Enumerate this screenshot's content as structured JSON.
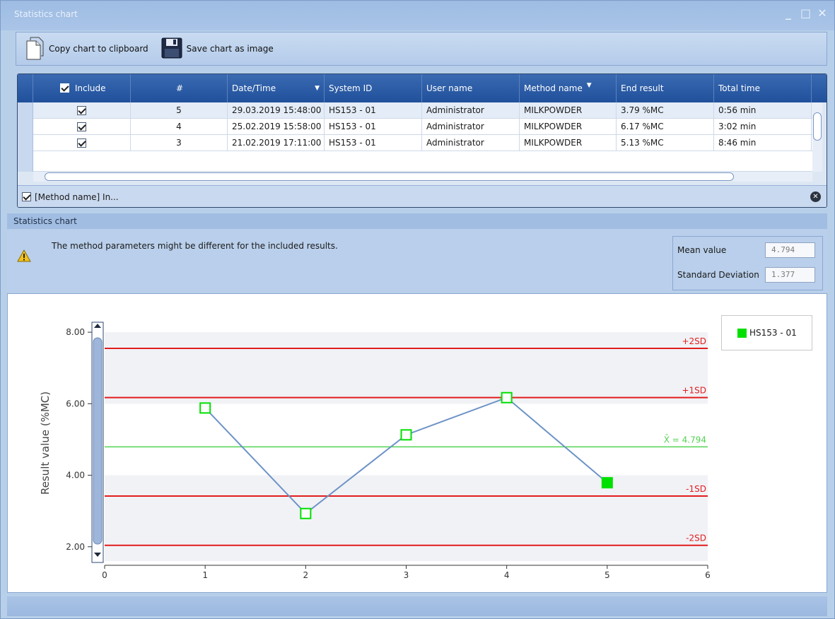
{
  "window": {
    "title": "Statistics chart",
    "minimize": "_",
    "maximize": "□",
    "close": "✕"
  },
  "toolbar": {
    "copy_label": "Copy chart  to clipboard",
    "save_label": "Save chart as image"
  },
  "grid": {
    "columns": [
      "Include",
      "#",
      "Date/Time",
      "System ID",
      "User name",
      "Method name",
      "End result",
      "Total time"
    ],
    "rows": [
      {
        "include": true,
        "num": "5",
        "datetime": "29.03.2019 15:48:00",
        "system_id": "HS153 - 01",
        "user": "Administrator",
        "method": "MILKPOWDER",
        "result": "3.79 %MC",
        "time": "0:56 min"
      },
      {
        "include": true,
        "num": "4",
        "datetime": "25.02.2019 15:58:00",
        "system_id": "HS153 - 01",
        "user": "Administrator",
        "method": "MILKPOWDER",
        "result": "6.17 %MC",
        "time": "3:02 min"
      },
      {
        "include": true,
        "num": "3",
        "datetime": "21.02.2019 17:11:00",
        "system_id": "HS153 - 01",
        "user": "Administrator",
        "method": "MILKPOWDER",
        "result": "5.13 %MC",
        "time": "8:46 min"
      }
    ],
    "filter_text": "[Method name] In..."
  },
  "stats": {
    "section_title": "Statistics chart",
    "warning": "The method parameters might be different for the included results.",
    "mean_label": "Mean value",
    "mean_value": "4.794",
    "sd_label": "Standard Deviation",
    "sd_value": "1.377"
  },
  "colors": {
    "point": "#00e000",
    "line": "#6d93c6",
    "limit": "#e21d1d",
    "mean": "#52d352"
  },
  "chart_data": {
    "type": "line",
    "ylabel": "Result value (%MC)",
    "xlabel": "",
    "xlim": [
      0,
      6
    ],
    "ylim": [
      1.6,
      8.2
    ],
    "x_ticks": [
      "0",
      "1",
      "2",
      "3",
      "4",
      "5",
      "6"
    ],
    "y_ticks": [
      "8.00",
      "6.00",
      "4.00",
      "2.00"
    ],
    "series": [
      {
        "name": "HS153 - 01",
        "x": [
          1,
          2,
          3,
          4,
          5
        ],
        "y": [
          5.88,
          2.93,
          5.13,
          6.17,
          3.79
        ]
      }
    ],
    "reference_lines": [
      {
        "label": "+2SD",
        "value": 7.548
      },
      {
        "label": "+1SD",
        "value": 6.171
      },
      {
        "label": "X̄ = 4.794",
        "value": 4.794
      },
      {
        "label": "-1SD",
        "value": 3.417
      },
      {
        "label": "-2SD",
        "value": 2.04
      }
    ],
    "legend": "right"
  }
}
